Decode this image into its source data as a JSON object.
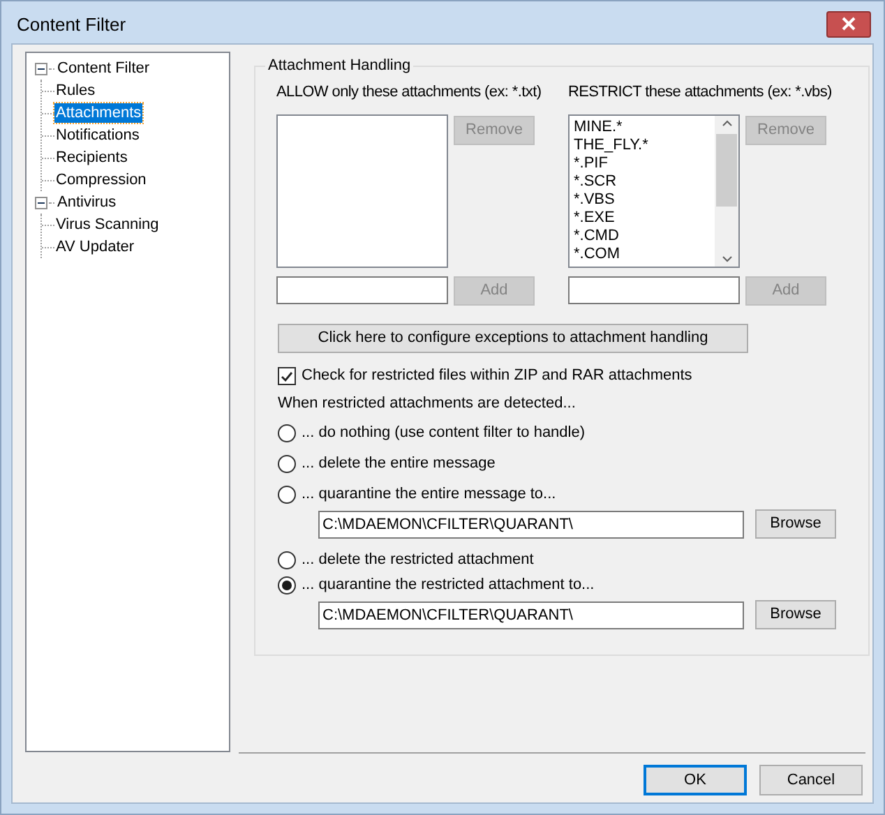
{
  "window": {
    "title": "Content Filter"
  },
  "tree": [
    {
      "label": "Content Filter",
      "selected": false,
      "expanded": true,
      "children": [
        {
          "label": "Rules",
          "selected": false
        },
        {
          "label": "Attachments",
          "selected": true
        },
        {
          "label": "Notifications",
          "selected": false
        },
        {
          "label": "Recipients",
          "selected": false
        },
        {
          "label": "Compression",
          "selected": false
        }
      ]
    },
    {
      "label": "Antivirus",
      "selected": false,
      "expanded": true,
      "children": [
        {
          "label": "Virus Scanning",
          "selected": false
        },
        {
          "label": "AV Updater",
          "selected": false
        }
      ]
    }
  ],
  "group": {
    "title": "Attachment Handling",
    "lists": [
      {
        "label": "ALLOW only these attachments (ex: *.txt)",
        "remove_button": {
          "label": "Remove",
          "disabled": true
        },
        "add_button": {
          "label": "Add",
          "disabled": true
        }
      },
      {
        "label": "RESTRICT these attachments (ex: *.vbs)",
        "items": [
          "MINE.*",
          "THE_FLY.*",
          "*.PIF",
          "*.SCR",
          "*.VBS",
          "*.EXE",
          "*.CMD",
          "*.COM"
        ],
        "remove_button": {
          "label": "Remove",
          "disabled": true
        },
        "add_button": {
          "label": "Add",
          "disabled": true
        }
      }
    ],
    "exceptions_button": "Click here to configure exceptions to attachment handling",
    "zip_check": {
      "label": "Check for restricted files within ZIP and RAR attachments",
      "checked": true
    },
    "prompt": "When restricted attachments are detected...",
    "actions": [
      {
        "label": "... do nothing (use content filter to handle)",
        "selected": false
      },
      {
        "label": "... delete the entire message",
        "selected": false
      },
      {
        "label": "... quarantine the entire message to...",
        "selected": false,
        "path": "C:\\MDAEMON\\CFILTER\\QUARANT\\",
        "browse": "Browse"
      },
      {
        "label": "... delete the restricted attachment",
        "selected": false
      },
      {
        "label": "... quarantine the restricted attachment to...",
        "selected": true,
        "path": "C:\\MDAEMON\\CFILTER\\QUARANT\\",
        "browse": "Browse"
      }
    ]
  },
  "buttons": [
    {
      "label": "OK",
      "default": true
    },
    {
      "label": "Cancel",
      "default": false
    }
  ]
}
